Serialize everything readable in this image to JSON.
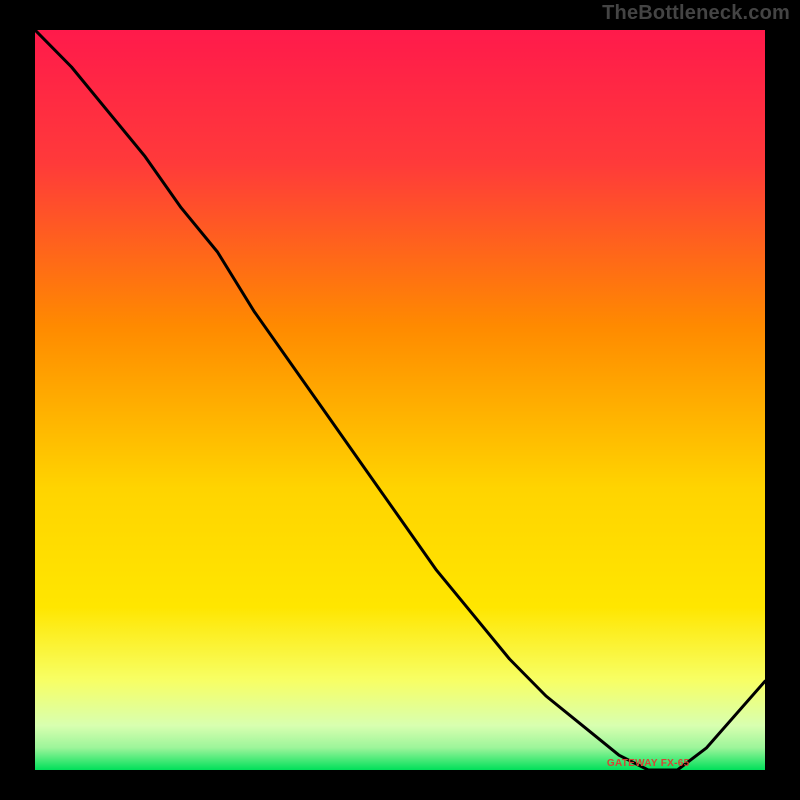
{
  "watermark": "TheBottleneck.com",
  "annotation_label": "GATEWAY FX-65",
  "colors": {
    "bg": "#000000",
    "grad_top": "#ff1a4b",
    "grad_mid1": "#ff8a00",
    "grad_mid2": "#ffe600",
    "grad_mid3": "#f7ff66",
    "grad_bottom": "#00e05a",
    "curve": "#000000",
    "annot": "#d64434"
  },
  "chart_data": {
    "type": "line",
    "title": "",
    "xlabel": "",
    "ylabel": "",
    "xlim": [
      0,
      100
    ],
    "ylim": [
      0,
      100
    ],
    "series": [
      {
        "name": "curve",
        "x": [
          0,
          5,
          10,
          15,
          20,
          25,
          30,
          35,
          40,
          45,
          50,
          55,
          60,
          65,
          70,
          75,
          80,
          82,
          84,
          88,
          92,
          100
        ],
        "y": [
          100,
          95,
          89,
          83,
          76,
          70,
          62,
          55,
          48,
          41,
          34,
          27,
          21,
          15,
          10,
          6,
          2,
          1,
          0,
          0,
          3,
          12
        ]
      }
    ],
    "annotation": {
      "label": "GATEWAY FX-65",
      "x": 84,
      "y": 0
    }
  }
}
